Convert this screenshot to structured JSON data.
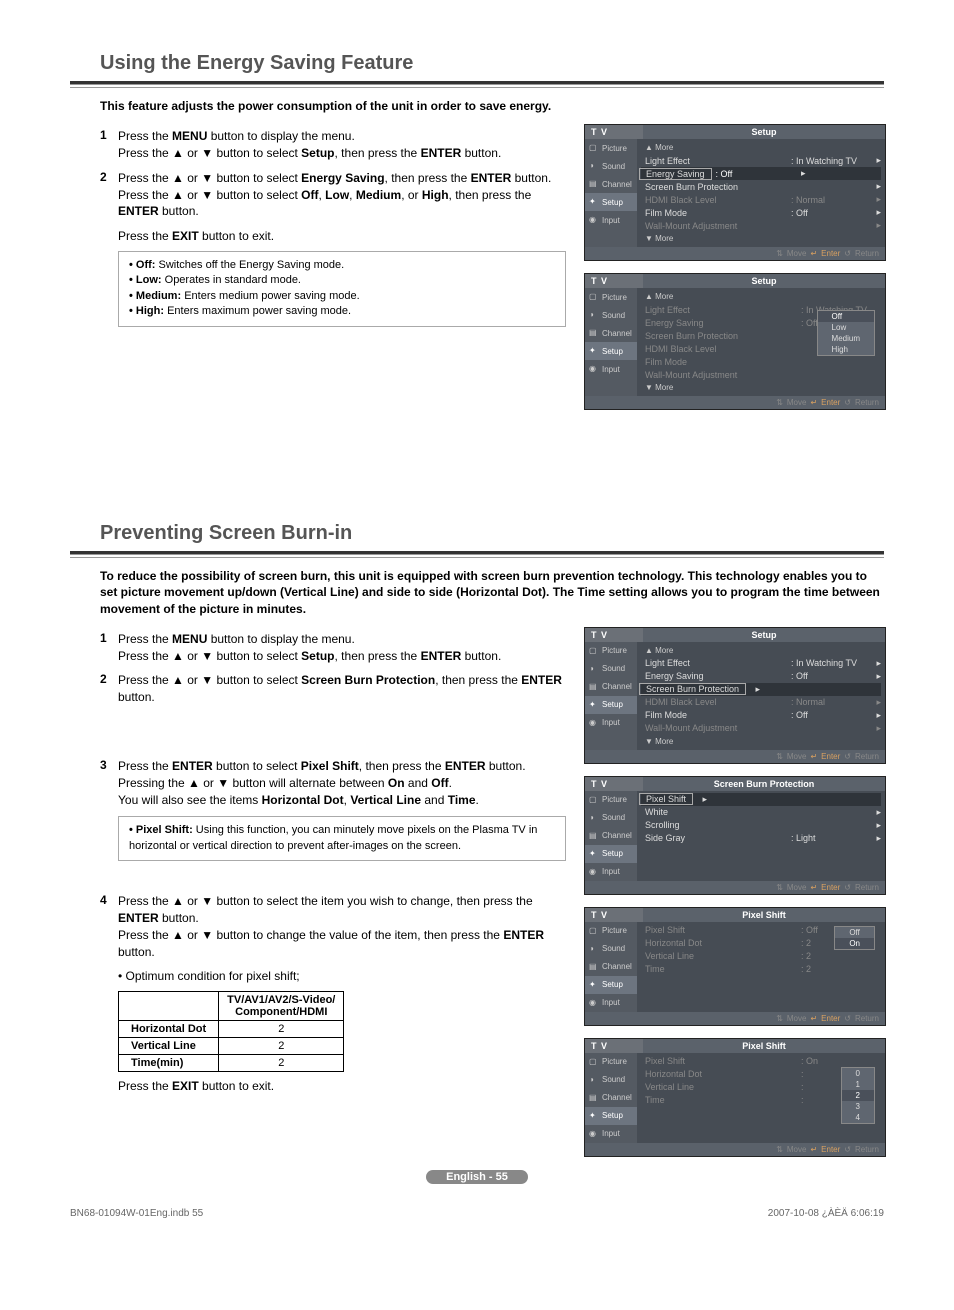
{
  "section1": {
    "title": "Using the Energy Saving Feature",
    "intro": "This feature adjusts the power consumption of the unit in order to save energy.",
    "steps": {
      "n1": "1",
      "s1a": "Press the ",
      "s1b": "MENU",
      "s1c": " button to display the menu.",
      "s1d": "Press the ▲ or ▼ button to select ",
      "s1e": "Setup",
      "s1f": ", then press the ",
      "s1g": "ENTER",
      "s1h": " button.",
      "n2": "2",
      "s2a": "Press the ▲ or ▼ button to select ",
      "s2b": "Energy Saving",
      "s2c": ", then press the ",
      "s2d": "ENTER",
      "s2e": " button.",
      "s2f": "Press the ▲ or ▼ button to select ",
      "s2g": "Off",
      "s2h": "Low",
      "s2i": "Medium",
      "s2j": "High",
      "s2k": ", then press the ",
      "s2l": "ENTER",
      "s2m": " button.",
      "exit1": "Press the ",
      "exit2": "EXIT",
      "exit3": " button to exit."
    },
    "notes": {
      "off_l": "• Off:",
      "off_t": " Switches off the Energy Saving mode.",
      "low_l": "• Low:",
      "low_t": " Operates in standard mode.",
      "med_l": "• Medium:",
      "med_t": " Enters medium power saving mode.",
      "high_l": "• High:",
      "high_t": " Enters maximum power saving mode."
    }
  },
  "section2": {
    "title": "Preventing Screen Burn-in",
    "intro": "To reduce the possibility of screen burn, this unit is equipped with screen burn prevention technology. This technology enables you to set picture movement up/down (Vertical Line) and side to side (Horizontal Dot). The Time setting allows you to program the time between movement of the picture in minutes.",
    "steps": {
      "n1": "1",
      "s1a": "Press the ",
      "s1b": "MENU",
      "s1c": " button to display the menu.",
      "s1d": "Press the ▲ or ▼ button to select ",
      "s1e": "Setup",
      "s1f": ", then press the ",
      "s1g": "ENTER",
      "s1h": " button.",
      "n2": "2",
      "s2a": "Press the ▲ or ▼ button to select ",
      "s2b": "Screen Burn Protection",
      "s2c": ", then press the ",
      "s2d": "ENTER",
      "s2e": " button.",
      "n3": "3",
      "s3a": "Press the ",
      "s3b": "ENTER",
      "s3c": " button to select ",
      "s3d": "Pixel Shift",
      "s3e": ", then press the ",
      "s3f": "ENTER",
      "s3g": " button.",
      "s3h": "Pressing the ▲ or ▼ button will alternate between ",
      "s3i": "On",
      "s3j": " and ",
      "s3k": "Off",
      "s3l": ".",
      "s3m": "You will also see the items ",
      "s3n": "Horizontal Dot",
      "s3o": ", ",
      "s3p": "Vertical Line",
      "s3q": " and ",
      "s3r": "Time",
      "s3s": ".",
      "note_l": "• Pixel Shift:",
      "note_t": " Using this function, you can minutely move pixels on the Plasma TV in horizontal or vertical direction to prevent after-images on the screen.",
      "n4": "4",
      "s4a": "Press the ▲ or ▼ button to select the item you wish to change, then press the ",
      "s4b": "ENTER",
      "s4c": " button.",
      "s4d": "Press the ▲ or ▼ button to change the value of the item, then press the ",
      "s4e": "ENTER",
      "s4f": " button.",
      "opt": "• Optimum condition for pixel shift;",
      "th": "TV/AV1/AV2/S-Video/\nComponent/HDMI",
      "r1": "Horizontal Dot",
      "r1v": "2",
      "r2": "Vertical Line",
      "r2v": "2",
      "r3": "Time(min)",
      "r3v": "2",
      "exit1": "Press the ",
      "exit2": "EXIT",
      "exit3": " button to exit."
    }
  },
  "osd": {
    "tv": "T V",
    "side": {
      "picture": "Picture",
      "sound": "Sound",
      "channel": "Channel",
      "setup": "Setup",
      "input": "Input"
    },
    "setup_title": "Setup",
    "sbp_title": "Screen Burn Protection",
    "ps_title": "Pixel Shift",
    "more_up": "▲ More",
    "more_dn": "▼ More",
    "rows1": {
      "light": "Light Effect",
      "light_v": ": In Watching TV",
      "energy": "Energy Saving",
      "energy_v": ": Off",
      "sbp": "Screen Burn Protection",
      "hdmi": "HDMI Black Level",
      "hdmi_v": ": Normal",
      "film": "Film Mode",
      "film_v": ": Off",
      "wall": "Wall-Mount Adjustment"
    },
    "popup1": {
      "off": "Off",
      "low": "Low",
      "med": "Medium",
      "high": "High"
    },
    "rows_sbp": {
      "ps": "Pixel Shift",
      "white": "White",
      "scroll": "Scrolling",
      "sg": "Side Gray",
      "sg_v": ": Light"
    },
    "rows_ps": {
      "ps": "Pixel Shift",
      "ps_v_off": ": Off",
      "ps_v_on": ": On",
      "hd": "Horizontal Dot",
      "hd_v2": ": 2",
      "vl": "Vertical Line",
      "vl_v2": ": 2",
      "tm": "Time",
      "tm_v2": ": 2"
    },
    "popup_on": {
      "off": "Off",
      "on": "On"
    },
    "popup_hd": {
      "v0": "0",
      "v1": "1",
      "v2": "2",
      "v3": "3",
      "v4": "4"
    },
    "foot": {
      "move": "Move",
      "enter": "Enter",
      "ret": "Return"
    }
  },
  "footer": {
    "page": "English - 55",
    "bl_left": "BN68-01094W-01Eng.indb   55",
    "bl_right": "2007-10-08   ¿ÀÈÄ 6:06:19"
  }
}
